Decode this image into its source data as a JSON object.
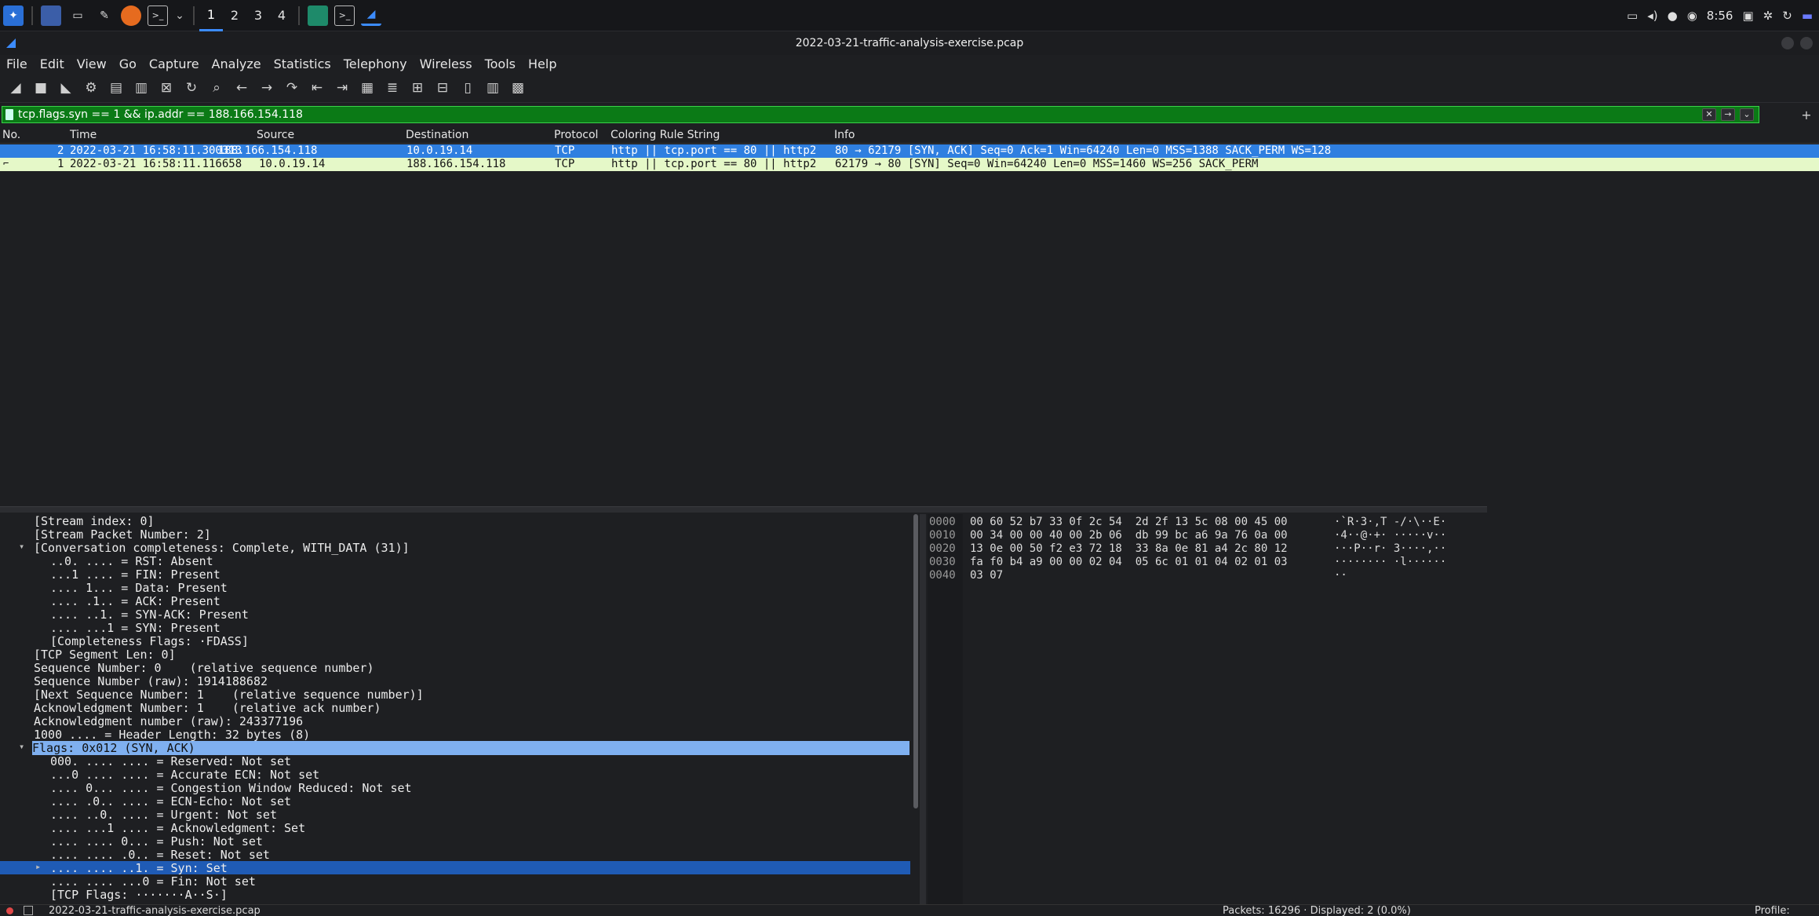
{
  "taskbar": {
    "workspaces": [
      "1",
      "2",
      "3",
      "4"
    ],
    "active_workspace": "1",
    "clock": "8:56"
  },
  "window": {
    "title": "2022-03-21-traffic-analysis-exercise.pcap"
  },
  "menu": [
    "File",
    "Edit",
    "View",
    "Go",
    "Capture",
    "Analyze",
    "Statistics",
    "Telephony",
    "Wireless",
    "Tools",
    "Help"
  ],
  "filter": {
    "value": "tcp.flags.syn == 1 && ip.addr == 188.166.154.118"
  },
  "packet_list": {
    "columns": [
      "No.",
      "Time",
      "Source",
      "Destination",
      "Protocol",
      "Coloring Rule String",
      "Info"
    ],
    "rows": [
      {
        "no": "2",
        "time": "2022-03-21 16:58:11.300313",
        "source": "188.166.154.118",
        "destination": "10.0.19.14",
        "protocol": "TCP",
        "rule": "http || tcp.port == 80 || http2",
        "info": "80 → 62179 [SYN, ACK] Seq=0 Ack=1 Win=64240 Len=0 MSS=1388 SACK_PERM WS=128"
      },
      {
        "no": "1",
        "time": "2022-03-21 16:58:11.116658",
        "source": "10.0.19.14",
        "destination": "188.166.154.118",
        "protocol": "TCP",
        "rule": "http || tcp.port == 80 || http2",
        "info": "62179 → 80 [SYN] Seq=0 Win=64240 Len=0 MSS=1460 WS=256 SACK_PERM"
      }
    ]
  },
  "details": [
    "[Stream index: 0]",
    "[Stream Packet Number: 2]",
    "[Conversation completeness: Complete, WITH_DATA (31)]",
    "..0. .... = RST: Absent",
    "...1 .... = FIN: Present",
    ".... 1... = Data: Present",
    ".... .1.. = ACK: Present",
    ".... ..1. = SYN-ACK: Present",
    ".... ...1 = SYN: Present",
    "[Completeness Flags: ·FDASS]",
    "[TCP Segment Len: 0]",
    "Sequence Number: 0    (relative sequence number)",
    "Sequence Number (raw): 1914188682",
    "[Next Sequence Number: 1    (relative sequence number)]",
    "Acknowledgment Number: 1    (relative ack number)",
    "Acknowledgment number (raw): 243377196",
    "1000 .... = Header Length: 32 bytes (8)",
    "Flags: 0x012 (SYN, ACK)",
    "000. .... .... = Reserved: Not set",
    "...0 .... .... = Accurate ECN: Not set",
    ".... 0... .... = Congestion Window Reduced: Not set",
    ".... .0.. .... = ECN-Echo: Not set",
    ".... ..0. .... = Urgent: Not set",
    ".... ...1 .... = Acknowledgment: Set",
    ".... .... 0... = Push: Not set",
    ".... .... .0.. = Reset: Not set",
    ".... .... ..1. = Syn: Set",
    ".... .... ...0 = Fin: Not set",
    "[TCP Flags: ·······A··S·]"
  ],
  "hex": [
    {
      "offset": "0000",
      "bytes": "00 60 52 b7 33 0f 2c 54  2d 2f 13 5c 08 00 45 00",
      "ascii": "·`R·3·,T -/·\\··E·"
    },
    {
      "offset": "0010",
      "bytes": "00 34 00 00 40 00 2b 06  db 99 bc a6 9a 76 0a 00",
      "ascii": "·4··@·+· ·····v··"
    },
    {
      "offset": "0020",
      "bytes": "13 0e 00 50 f2 e3 72 18  33 8a 0e 81 a4 2c 80 12",
      "ascii": "···P··r· 3····,··"
    },
    {
      "offset": "0030",
      "bytes": "fa f0 b4 a9 00 00 02 04  05 6c 01 01 04 02 01 03",
      "ascii": "········ ·l······"
    },
    {
      "offset": "0040",
      "bytes": "03 07",
      "ascii": "··"
    }
  ],
  "status": {
    "file": "2022-03-21-traffic-analysis-exercise.pcap",
    "packets": "Packets: 16296 · Displayed: 2 (0.0%)",
    "profile": "Profile: Default"
  }
}
